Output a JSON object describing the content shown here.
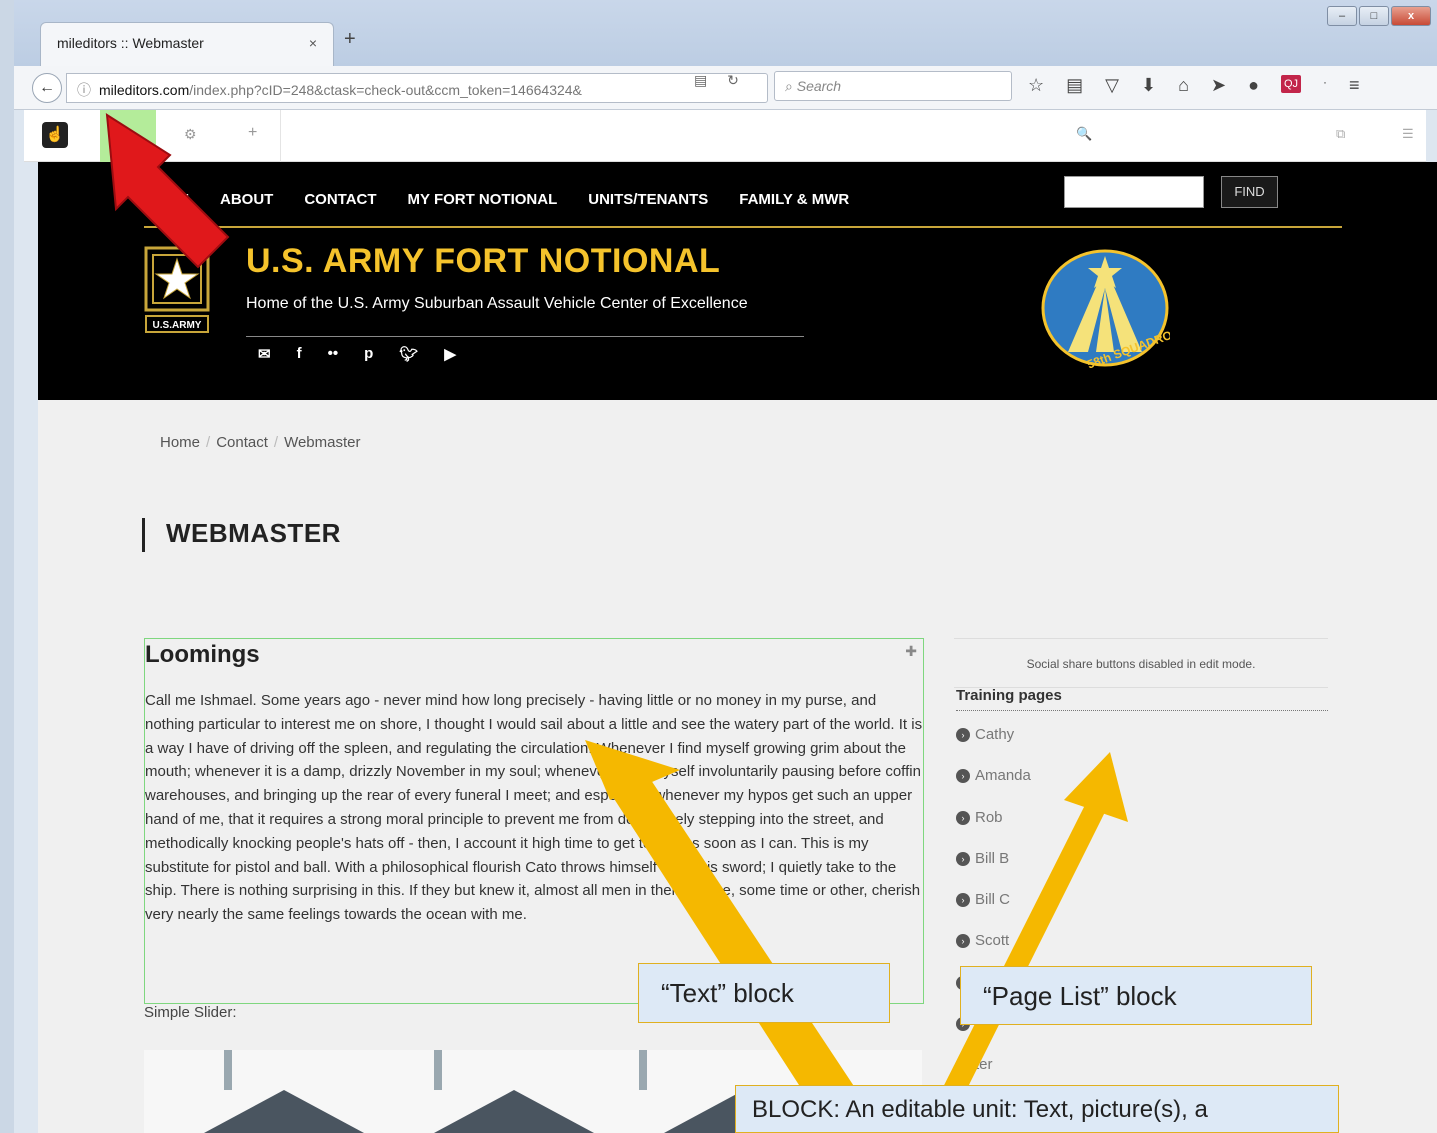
{
  "browser": {
    "tab_title": "mileditors :: Webmaster",
    "tab_close": "×",
    "new_tab": "+",
    "url_host": "mileditors.com",
    "url_path": "/index.php?cID=248&ctask=check-out&ccm_token=14664324&",
    "search_placeholder": "Search",
    "win_minimize": "–",
    "win_maximize": "□",
    "win_close": "x",
    "addon_label": "QJ"
  },
  "cms": {
    "logo": "☝",
    "gear": "⚙",
    "add": "+",
    "search": "🔍",
    "pages": "⧉",
    "settings": "☰"
  },
  "site": {
    "nav": [
      "HOME",
      "ABOUT",
      "CONTACT",
      "MY FORT NOTIONAL",
      "UNITS/TENANTS",
      "FAMILY & MWR"
    ],
    "find_label": "FIND",
    "title": "U.S. ARMY FORT NOTIONAL",
    "subtitle": "Home of the U.S. Army Suburban Assault Vehicle Center of Excellence",
    "army_label": "U.S.ARMY",
    "badge_text": "58th SQUADRON",
    "social_icons": [
      "mail-icon",
      "facebook-icon",
      "flickr-icon",
      "pinterest-icon",
      "twitter-icon",
      "youtube-icon"
    ]
  },
  "breadcrumb": [
    "Home",
    "Contact",
    "Webmaster"
  ],
  "page_title": "WEBMASTER",
  "text_block": {
    "heading": "Loomings",
    "body": "Call me Ishmael. Some years ago - never mind how long precisely - having little or no money in my purse, and nothing particular to interest me on shore, I thought I would sail about a little and see the watery part of the world. It is a way I have of driving off the spleen, and regulating the circulation. Whenever I find myself growing grim about the mouth; whenever it is a damp, drizzly November in my soul; whenever I find myself involuntarily pausing before coffin warehouses, and bringing up the rear of every funeral I meet; and especially whenever my hypos get such an upper hand of me, that it requires a strong moral principle to prevent me from deliberately stepping into the street, and methodically knocking people's hats off - then, I account it high time to get to sea as soon as I can. This is my substitute for pistol and ball. With a philosophical flourish Cato throws himself upon his sword; I quietly take to the ship. There is nothing surprising in this. If they but knew it, almost all men in their degree, some time or other, cherish very nearly the same feelings towards the ocean with me."
  },
  "slider_label": "Simple Slider:",
  "sidebar": {
    "share_notice": "Social share buttons disabled in edit mode.",
    "title": "Training pages",
    "pages": [
      "Cathy",
      "Amanda",
      "Rob",
      "Bill B",
      "Bill C",
      "Scott",
      "",
      "Mi",
      "ter"
    ]
  },
  "callouts": {
    "text_block": "“Text” block",
    "page_list": "“Page List” block",
    "definition": "BLOCK: An editable unit: Text, picture(s), a"
  },
  "colors": {
    "header_bg": "#000000",
    "title_gold": "#f5c32c",
    "arrow_red": "#e0181b",
    "arrow_gold": "#f5b800",
    "edit_green": "#b4ec9a"
  }
}
